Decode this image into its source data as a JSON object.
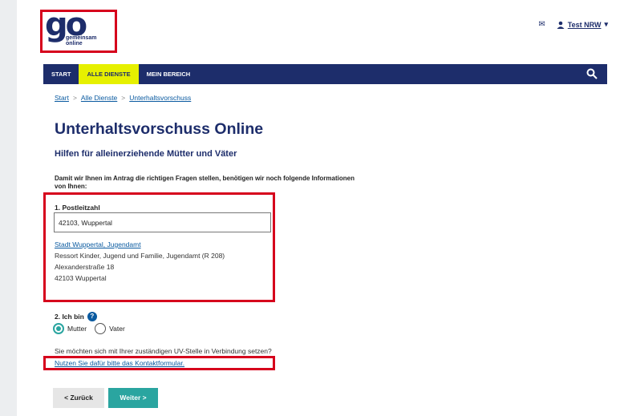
{
  "logo": {
    "mark": "go",
    "line1": "gemeinsam",
    "line2": "online"
  },
  "header": {
    "user_name": "Test NRW"
  },
  "nav": {
    "items": [
      "START",
      "ALLE DIENSTE",
      "MEIN BEREICH"
    ],
    "active_index": 1
  },
  "breadcrumb": {
    "items": [
      "Start",
      "Alle Dienste",
      "Unterhaltsvorschuss"
    ],
    "separator": ">"
  },
  "page": {
    "title": "Unterhaltsvorschuss Online",
    "subtitle": "Hilfen für alleinerziehende Mütter und Väter",
    "intro": "Damit wir Ihnen im Antrag die richtigen Fragen stellen, benötigen wir noch folgende Informationen von Ihnen:"
  },
  "postcode": {
    "label": "1. Postleitzahl",
    "value": "42103, Wuppertal",
    "office_link": "Stadt Wuppertal, Jugendamt",
    "office_dept": "Ressort Kinder, Jugend und Familie, Jugendamt (R 208)",
    "office_street": "Alexanderstraße 18",
    "office_city": "42103 Wuppertal"
  },
  "role": {
    "label": "2. Ich bin",
    "help": "?",
    "options": [
      "Mutter",
      "Vater"
    ],
    "selected": "Mutter"
  },
  "contact": {
    "question": "Sie möchten sich mit Ihrer zuständigen UV-Stelle in Verbindung setzen?",
    "link": "Nutzen Sie dafür bitte das Kontaktformular."
  },
  "buttons": {
    "back": "< Zurück",
    "next": "Weiter >"
  },
  "colors": {
    "brand_navy": "#1d2d6b",
    "accent_yellow": "#e6f000",
    "teal": "#2aa5a0",
    "highlight_red": "#d6001c",
    "link": "#0a5aa0"
  }
}
